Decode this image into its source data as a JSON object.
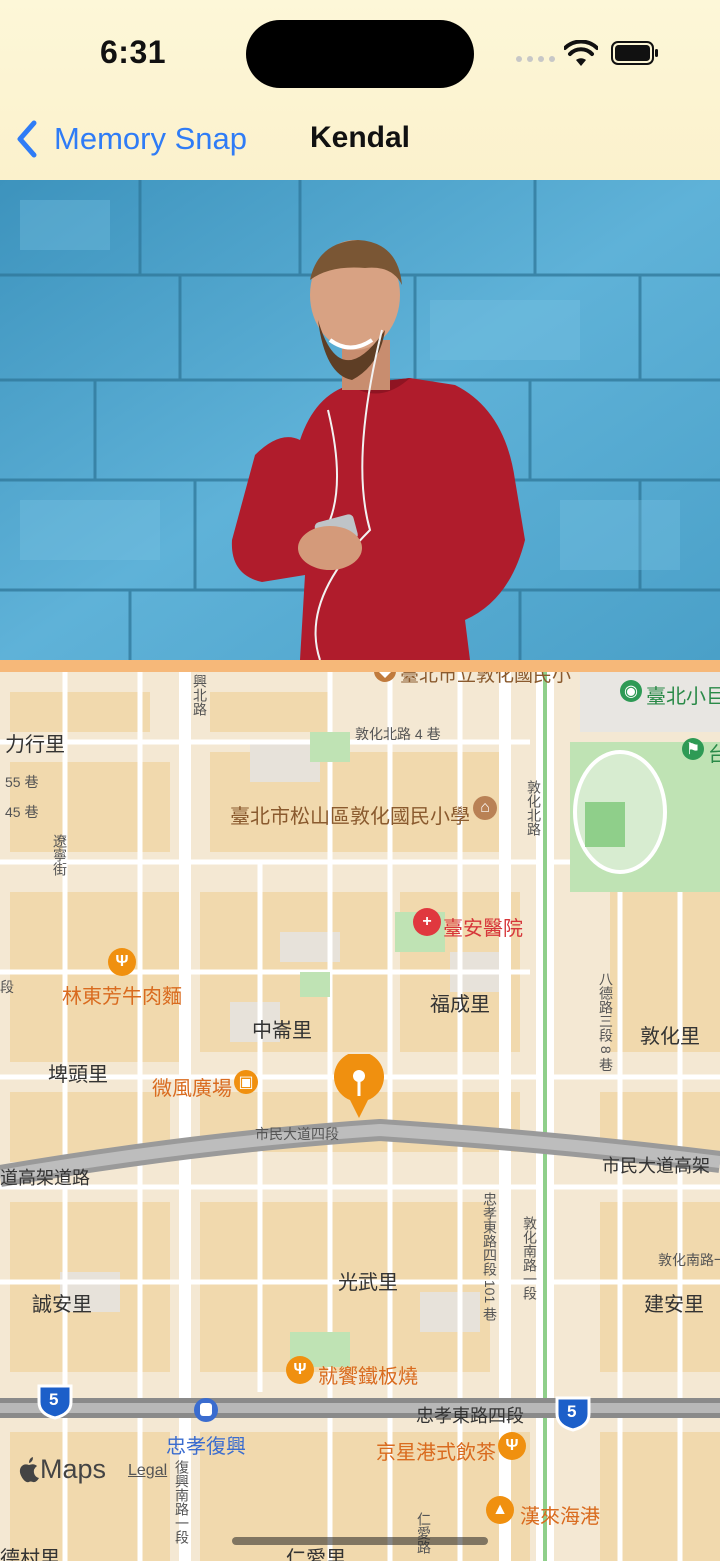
{
  "status_bar": {
    "time": "6:31"
  },
  "nav": {
    "back_label": "Memory Snap",
    "title": "Kendal"
  },
  "colors": {
    "accent": "#2f7cf6",
    "header_bg": "#fdf7d8",
    "divider": "#f6b879",
    "pin": "#f0900f"
  },
  "map": {
    "labels": {
      "school": "臺北市松山區敦化國民小學",
      "school_top": "臺北市立敦化國民小",
      "park_top": "臺北小巨",
      "park_right": "台",
      "hospital": "臺安醫院",
      "restaurant1": "林東芳牛肉麵",
      "plaza": "微風廣場",
      "restaurant2": "就饗鐵板燒",
      "restaurant3": "京星港式飲茶",
      "restaurant4": "漢來海港",
      "station": "忠孝復興",
      "li_lixing": "力行里",
      "li_fucheng": "福成里",
      "li_zhonglun": "中崙里",
      "li_pitou": "埤頭里",
      "li_dunhua": "敦化里",
      "li_guangwu": "光武里",
      "li_chengan": "誠安里",
      "li_jianan": "建安里",
      "li_renai": "仁愛里",
      "li_bottom_left": "德村里"
    },
    "roads": {
      "civic_blvd": "市民大道四段",
      "civic_hw_right": "市民大道高架",
      "civic_hw_left": "道高架道路",
      "zhongxiao": "忠孝東路四段",
      "dunhua_n_ln4": "敦化北路 4 巷",
      "lane55": "55 巷",
      "lane45": "45 巷",
      "dunhua_n_ln": "敦化南路一段",
      "dunhua_s": "敦化南路一段",
      "bade": "八德路三段 8 巷",
      "zhongxiao_101": "忠孝東路四段 101 巷",
      "fuxing_n": "興北路",
      "fuxing_s": "復興南路一段",
      "dunhua_n": "敦化北路",
      "liaoning": "遼寧街",
      "renai": "仁愛路",
      "duan": "段"
    },
    "shields": [
      "5",
      "5"
    ],
    "attribution": {
      "logo": "Maps",
      "legal": "Legal"
    }
  }
}
